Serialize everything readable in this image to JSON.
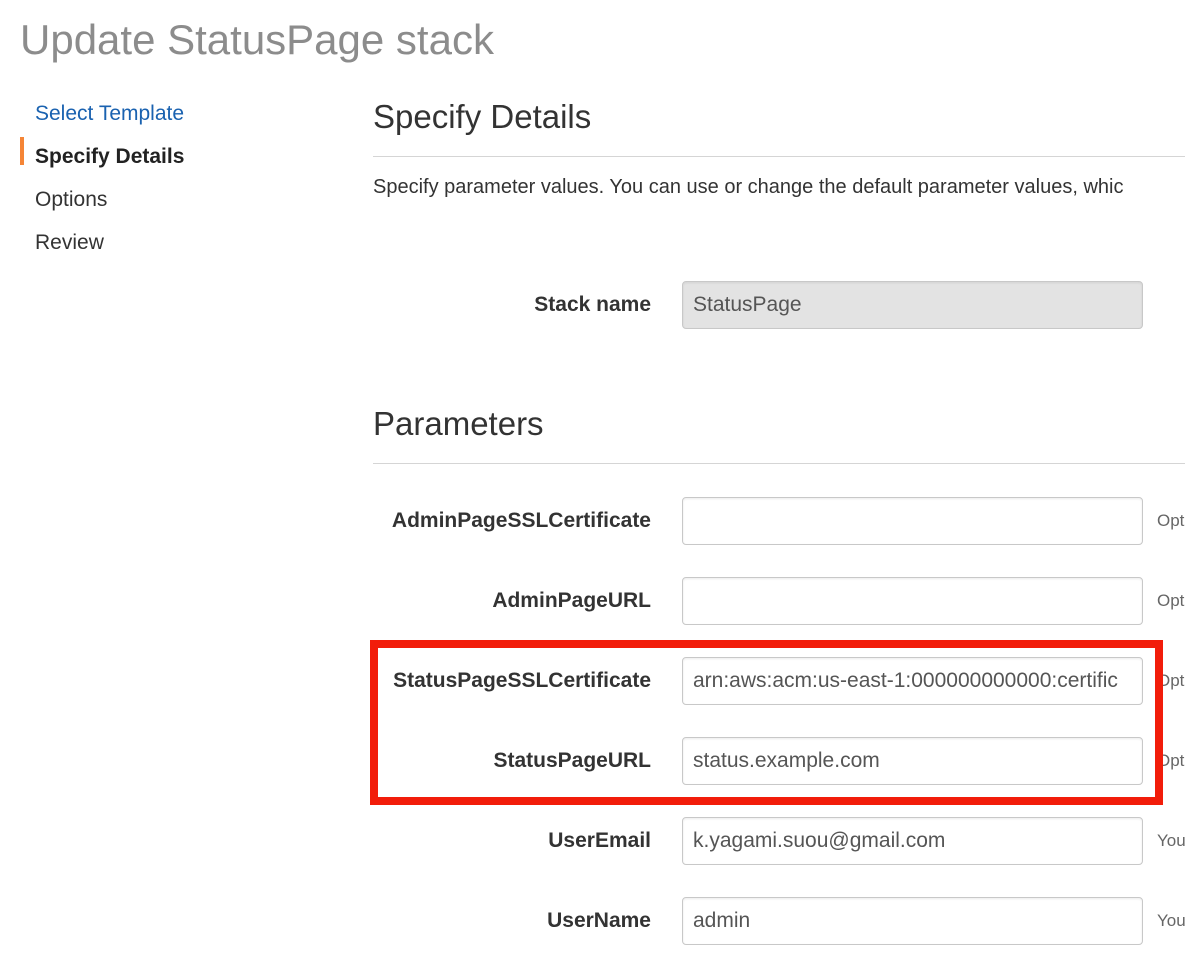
{
  "page": {
    "title": "Update StatusPage stack"
  },
  "sidebar": {
    "steps": [
      {
        "label": "Select Template"
      },
      {
        "label": "Specify Details"
      },
      {
        "label": "Options"
      },
      {
        "label": "Review"
      }
    ],
    "active_step": "Specify Details",
    "accent_color": "#f58536",
    "link_color": "#1a62b0"
  },
  "details": {
    "heading": "Specify Details",
    "description": "Specify parameter values. You can use or change the default parameter values, whic",
    "stack_name": {
      "label": "Stack name",
      "value": "StatusPage"
    }
  },
  "parameters": {
    "heading": "Parameters",
    "fields": [
      {
        "label": "AdminPageSSLCertificate",
        "value": "",
        "hint": "Opt"
      },
      {
        "label": "AdminPageURL",
        "value": "",
        "hint": "Opt"
      },
      {
        "label": "StatusPageSSLCertificate",
        "value": "arn:aws:acm:us-east-1:000000000000:certific",
        "hint": "Opt"
      },
      {
        "label": "StatusPageURL",
        "value": "status.example.com",
        "hint": "Opt"
      },
      {
        "label": "UserEmail",
        "value": "k.yagami.suou@gmail.com",
        "hint": "You"
      },
      {
        "label": "UserName",
        "value": "admin",
        "hint": "You"
      }
    ]
  },
  "annotation": {
    "highlight_color": "#f21d0a"
  }
}
